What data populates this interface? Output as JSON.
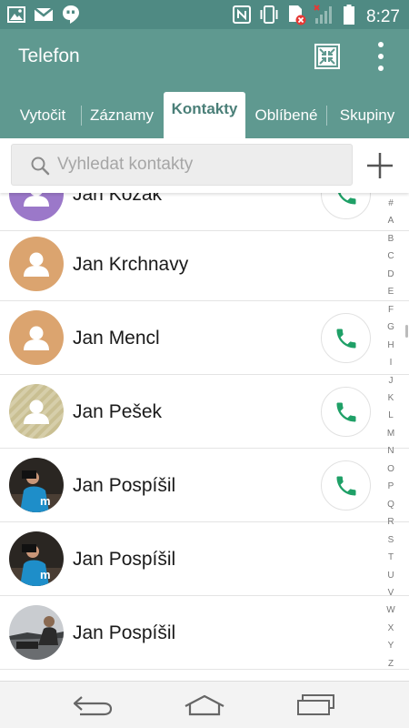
{
  "status_bar": {
    "time": "8:27",
    "left_icons": [
      "image-icon",
      "gmail-icon",
      "hangouts-icon"
    ],
    "right_icons": [
      "nfc-icon",
      "vibrate-icon",
      "no-sim-icon",
      "signal-icon",
      "battery-icon"
    ]
  },
  "app": {
    "title": "Telefon",
    "actions": [
      "compact-view-icon",
      "more-vert-icon"
    ]
  },
  "tabs": [
    {
      "label": "Vytočit",
      "active": false
    },
    {
      "label": "Záznamy",
      "active": false
    },
    {
      "label": "Kontakty",
      "active": true
    },
    {
      "label": "Oblíbené",
      "active": false
    },
    {
      "label": "Skupiny",
      "active": false
    }
  ],
  "search": {
    "placeholder": "Vyhledat kontakty",
    "value": ""
  },
  "contacts": [
    {
      "name": "Jan Kozák",
      "avatar": "placeholder-purple",
      "has_call": true
    },
    {
      "name": "Jan Krchnavy",
      "avatar": "placeholder-orange",
      "has_call": false
    },
    {
      "name": "Jan Mencl",
      "avatar": "placeholder-orange",
      "has_call": true
    },
    {
      "name": "Jan Pešek",
      "avatar": "placeholder-striped",
      "has_call": true
    },
    {
      "name": "Jan Pospíšil",
      "avatar": "photo-photographer",
      "has_call": true
    },
    {
      "name": "Jan Pospíšil",
      "avatar": "photo-photographer",
      "has_call": false
    },
    {
      "name": "Jan Pospíšil",
      "avatar": "photo-outdoor",
      "has_call": false
    }
  ],
  "index_letters": [
    "#",
    "A",
    "B",
    "C",
    "D",
    "E",
    "F",
    "G",
    "H",
    "I",
    "J",
    "K",
    "L",
    "M",
    "N",
    "O",
    "P",
    "Q",
    "R",
    "S",
    "T",
    "U",
    "V",
    "W",
    "X",
    "Y",
    "Z"
  ],
  "nav": [
    "back-icon",
    "home-icon",
    "recent-apps-icon"
  ],
  "colors": {
    "primary": "#5f9990",
    "status_bar": "#4f8a83",
    "active_tab_text": "#4a7f78",
    "call_green": "#1fa067"
  }
}
